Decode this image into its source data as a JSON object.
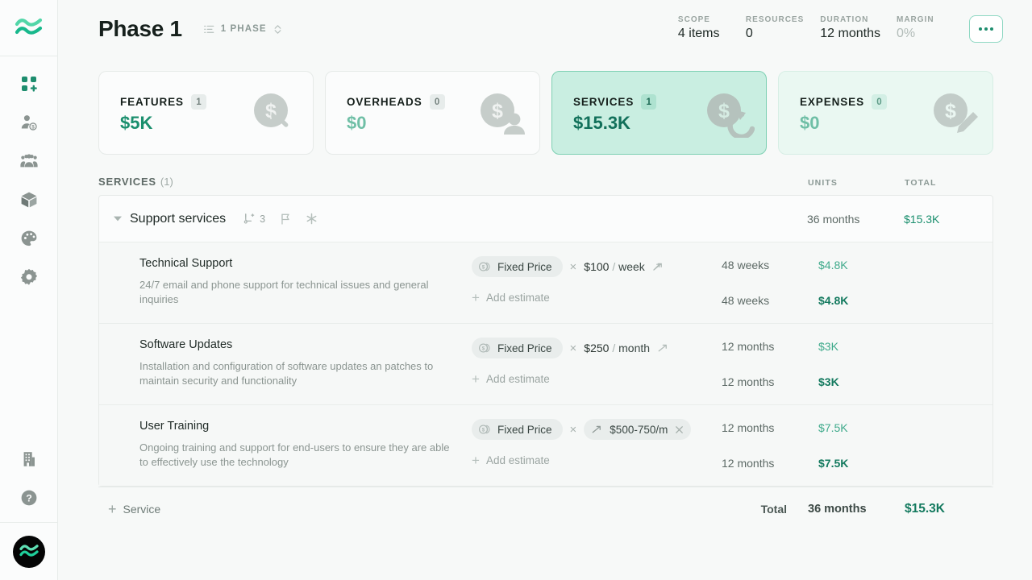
{
  "sidebar": {
    "logo": "wave-logo",
    "items": [
      {
        "icon": "dashboard-plus-icon",
        "active": true
      },
      {
        "icon": "person-dollar-icon",
        "active": false
      },
      {
        "icon": "people-group-icon",
        "active": false
      },
      {
        "icon": "package-box-icon",
        "active": false
      },
      {
        "icon": "palette-icon",
        "active": false
      },
      {
        "icon": "gear-icon",
        "active": false
      }
    ],
    "bottom_items": [
      {
        "icon": "building-icon"
      },
      {
        "icon": "help-circle-icon"
      }
    ],
    "avatar": "wave-avatar"
  },
  "header": {
    "title": "Phase 1",
    "phase_selector": {
      "label": "1 PHASE",
      "icon": "list-ordered-icon",
      "chevron": "chevron-updown-icon"
    },
    "metrics": [
      {
        "key": "SCOPE",
        "value": "4 items",
        "muted": false
      },
      {
        "key": "RESOURCES",
        "value": "0",
        "muted": false
      },
      {
        "key": "DURATION",
        "value": "12 months",
        "muted": false
      },
      {
        "key": "MARGIN",
        "value": "0%",
        "muted": true
      }
    ],
    "more_button": "more-options-button"
  },
  "summary_cards": [
    {
      "name": "FEATURES",
      "count": "1",
      "value": "$5K",
      "state": "default",
      "art": "coin-wrench-icon"
    },
    {
      "name": "OVERHEADS",
      "count": "0",
      "value": "$0",
      "state": "default",
      "art": "coin-person-icon"
    },
    {
      "name": "SERVICES",
      "count": "1",
      "value": "$15.3K",
      "state": "selected",
      "art": "coin-refresh-icon"
    },
    {
      "name": "EXPENSES",
      "count": "0",
      "value": "$0",
      "state": "tinted",
      "art": "coin-pencil-icon"
    }
  ],
  "section": {
    "title": "SERVICES",
    "count": "(1)",
    "columns": {
      "units": "UNITS",
      "total": "TOTAL"
    }
  },
  "group": {
    "name": "Support services",
    "caret": "caret-down-icon",
    "meta": [
      {
        "icon": "subitems-icon",
        "count": "3"
      },
      {
        "icon": "flag-icon",
        "count": ""
      },
      {
        "icon": "asterisk-icon",
        "count": ""
      }
    ],
    "units": "36 months",
    "total": "$15.3K"
  },
  "items": [
    {
      "name": "Technical Support",
      "description": "24/7 email and phone support for technical issues and general inquiries",
      "pricing_type": "Fixed Price",
      "pricing_icon": "coins-icon",
      "multiply": "×",
      "rate_amount": "$100",
      "rate_sep": "/",
      "rate_unit": "week",
      "rate_trend_icon": "trend-up-icon",
      "range_pill": null,
      "add_estimate": "Add estimate",
      "units_top": "48 weeks",
      "total_top": "$4.8K",
      "units_bottom": "48 weeks",
      "total_bottom": "$4.8K"
    },
    {
      "name": "Software Updates",
      "description": "Installation and configuration of software updates an patches to maintain security and functionality",
      "pricing_type": "Fixed Price",
      "pricing_icon": "coins-icon",
      "multiply": "×",
      "rate_amount": "$250",
      "rate_sep": "/",
      "rate_unit": "month",
      "rate_trend_icon": "trend-up-icon",
      "range_pill": null,
      "add_estimate": "Add estimate",
      "units_top": "12 months",
      "total_top": "$3K",
      "units_bottom": "12 months",
      "total_bottom": "$3K"
    },
    {
      "name": "User Training",
      "description": "Ongoing training and support for end-users to ensure they are able to effectively use the technology",
      "pricing_type": "Fixed Price",
      "pricing_icon": "coins-icon",
      "multiply": "×",
      "rate_amount": "",
      "rate_sep": "",
      "rate_unit": "",
      "rate_trend_icon": "trend-up-icon",
      "range_pill": {
        "label": "$500-750/m",
        "trend_icon": "trend-up-icon",
        "remove_icon": "close-icon"
      },
      "add_estimate": "Add estimate",
      "units_top": "12 months",
      "total_top": "$7.5K",
      "units_bottom": "12 months",
      "total_bottom": "$7.5K"
    }
  ],
  "footer": {
    "add_label": "Service",
    "total_label": "Total",
    "total_units": "36 months",
    "total_amount": "$15.3K"
  },
  "colors": {
    "accent_teal": "#1b8f6e",
    "selected_card_bg": "#c9eee1",
    "selected_card_border": "#7ed0b3",
    "tinted_card_bg": "#eaf8f2",
    "page_bg": "#f7f9f8"
  }
}
